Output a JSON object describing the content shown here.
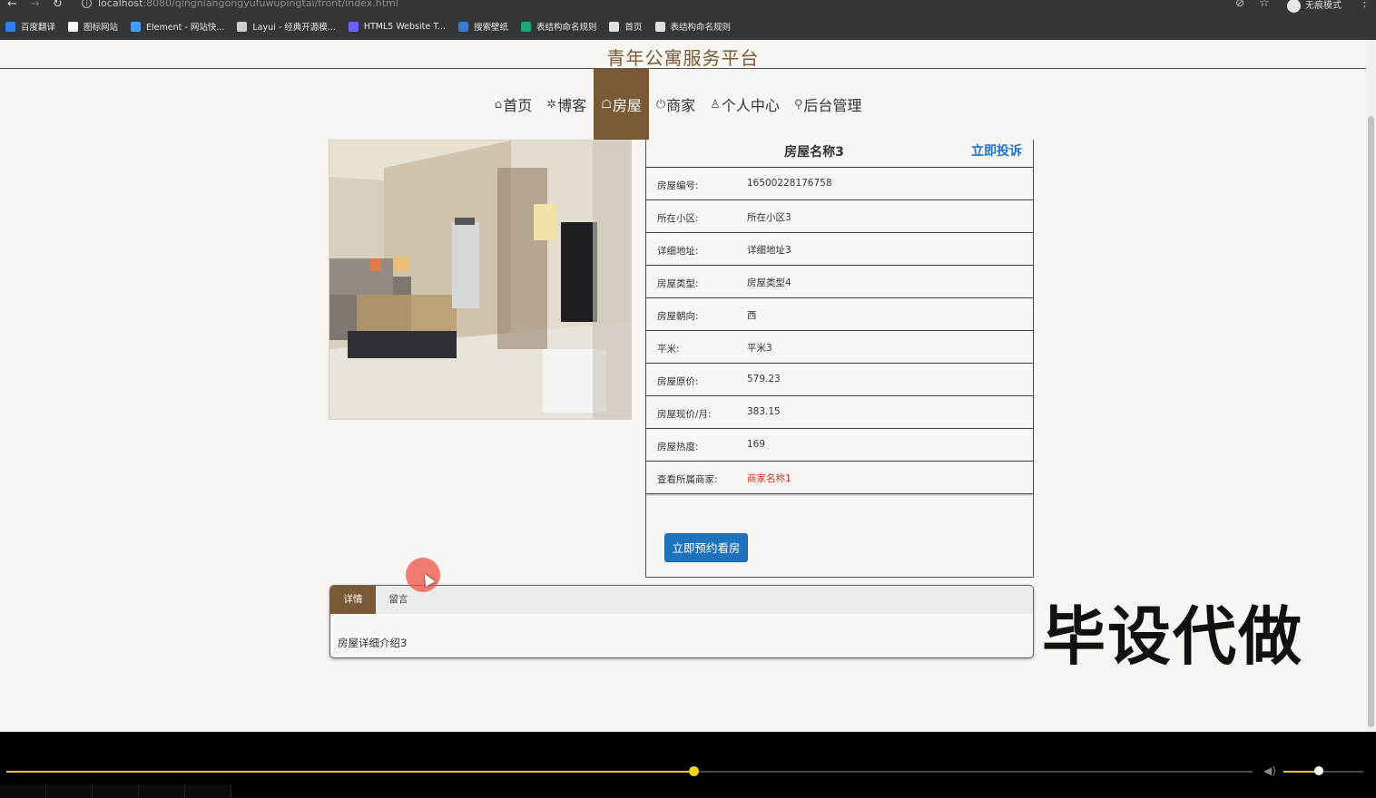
{
  "browser": {
    "url_host": "localhost",
    "url_rest": ":8080/qingniangongyufuwupingtai/front/index.html",
    "incognito_label": "无痕模式",
    "bookmarks": [
      {
        "label": "百度翻译",
        "color": "#2f80ed"
      },
      {
        "label": "图标网站",
        "color": "#ffffff"
      },
      {
        "label": "Element - 网站快...",
        "color": "#409eff"
      },
      {
        "label": "Layui - 经典开源模...",
        "color": "#cfcfcf"
      },
      {
        "label": "HTML5 Website T...",
        "color": "#6b63ff"
      },
      {
        "label": "搜索壁纸",
        "color": "#3a7bd5"
      },
      {
        "label": "表结构命名规则",
        "color": "#19a974"
      },
      {
        "label": "首页",
        "color": "#e0e0e0"
      },
      {
        "label": "表结构命名规则",
        "color": "#e0e0e0"
      }
    ]
  },
  "site": {
    "title": "青年公寓服务平台",
    "nav": [
      {
        "icon": "home-icon",
        "glyph": "⌂",
        "label": "首页",
        "active": false
      },
      {
        "icon": "blog-icon",
        "glyph": "✲",
        "label": "博客",
        "active": false
      },
      {
        "icon": "house-icon",
        "glyph": "☖",
        "label": "房屋",
        "active": true
      },
      {
        "icon": "power-icon",
        "glyph": "⏻",
        "label": "商家",
        "active": false
      },
      {
        "icon": "user-icon",
        "glyph": "♙",
        "label": "个人中心",
        "active": false
      },
      {
        "icon": "link-icon",
        "glyph": "⚲",
        "label": "后台管理",
        "active": false
      }
    ]
  },
  "house": {
    "name": "房屋名称3",
    "complain_label": "立即投诉",
    "fields": [
      {
        "label": "房屋编号:",
        "value": "16500228176758",
        "link": false
      },
      {
        "label": "所在小区:",
        "value": "所在小区3",
        "link": false
      },
      {
        "label": "详细地址:",
        "value": "详细地址3",
        "link": false
      },
      {
        "label": "房屋类型:",
        "value": "房屋类型4",
        "link": false
      },
      {
        "label": "房屋朝向:",
        "value": "西",
        "link": false
      },
      {
        "label": "平米:",
        "value": "平米3",
        "link": false
      },
      {
        "label": "房屋原价:",
        "value": "579.23",
        "link": false
      },
      {
        "label": "房屋现价/月:",
        "value": "383.15",
        "link": false
      },
      {
        "label": "房屋热度:",
        "value": "169",
        "link": false
      },
      {
        "label": "查看所属商家:",
        "value": "商家名称1",
        "link": true
      }
    ],
    "book_label": "立即预约看房"
  },
  "tabs": {
    "items": [
      {
        "label": "详情",
        "active": true
      },
      {
        "label": "留言",
        "active": false
      }
    ],
    "content": "房屋详细介绍3"
  },
  "watermark": "毕设代做",
  "player": {
    "progress_fraction": 0.551,
    "volume_fraction": 0.44
  }
}
